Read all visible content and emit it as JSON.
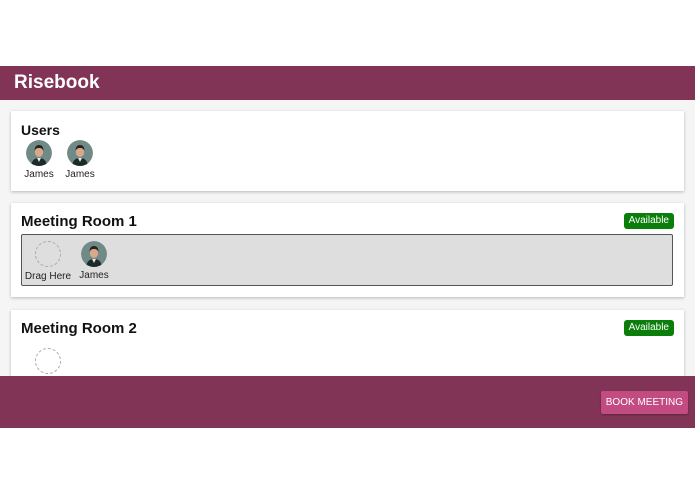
{
  "app": {
    "title": "Risebook"
  },
  "users_panel": {
    "title": "Users",
    "users": [
      {
        "name": "James",
        "avatar_icon": "user-avatar-icon"
      },
      {
        "name": "James",
        "avatar_icon": "user-avatar-icon"
      }
    ]
  },
  "rooms": [
    {
      "title": "Meeting Room 1",
      "status": "Available",
      "drop_label": "Drag Here",
      "attendees": [
        {
          "name": "James",
          "avatar_icon": "user-avatar-icon"
        }
      ]
    },
    {
      "title": "Meeting Room 2",
      "status": "Available",
      "drop_label": "",
      "attendees": []
    }
  ],
  "footer": {
    "book_label": "BOOK MEETING"
  },
  "colors": {
    "brand": "#823457",
    "button": "#c24c82",
    "available": "#0a7d0a"
  }
}
